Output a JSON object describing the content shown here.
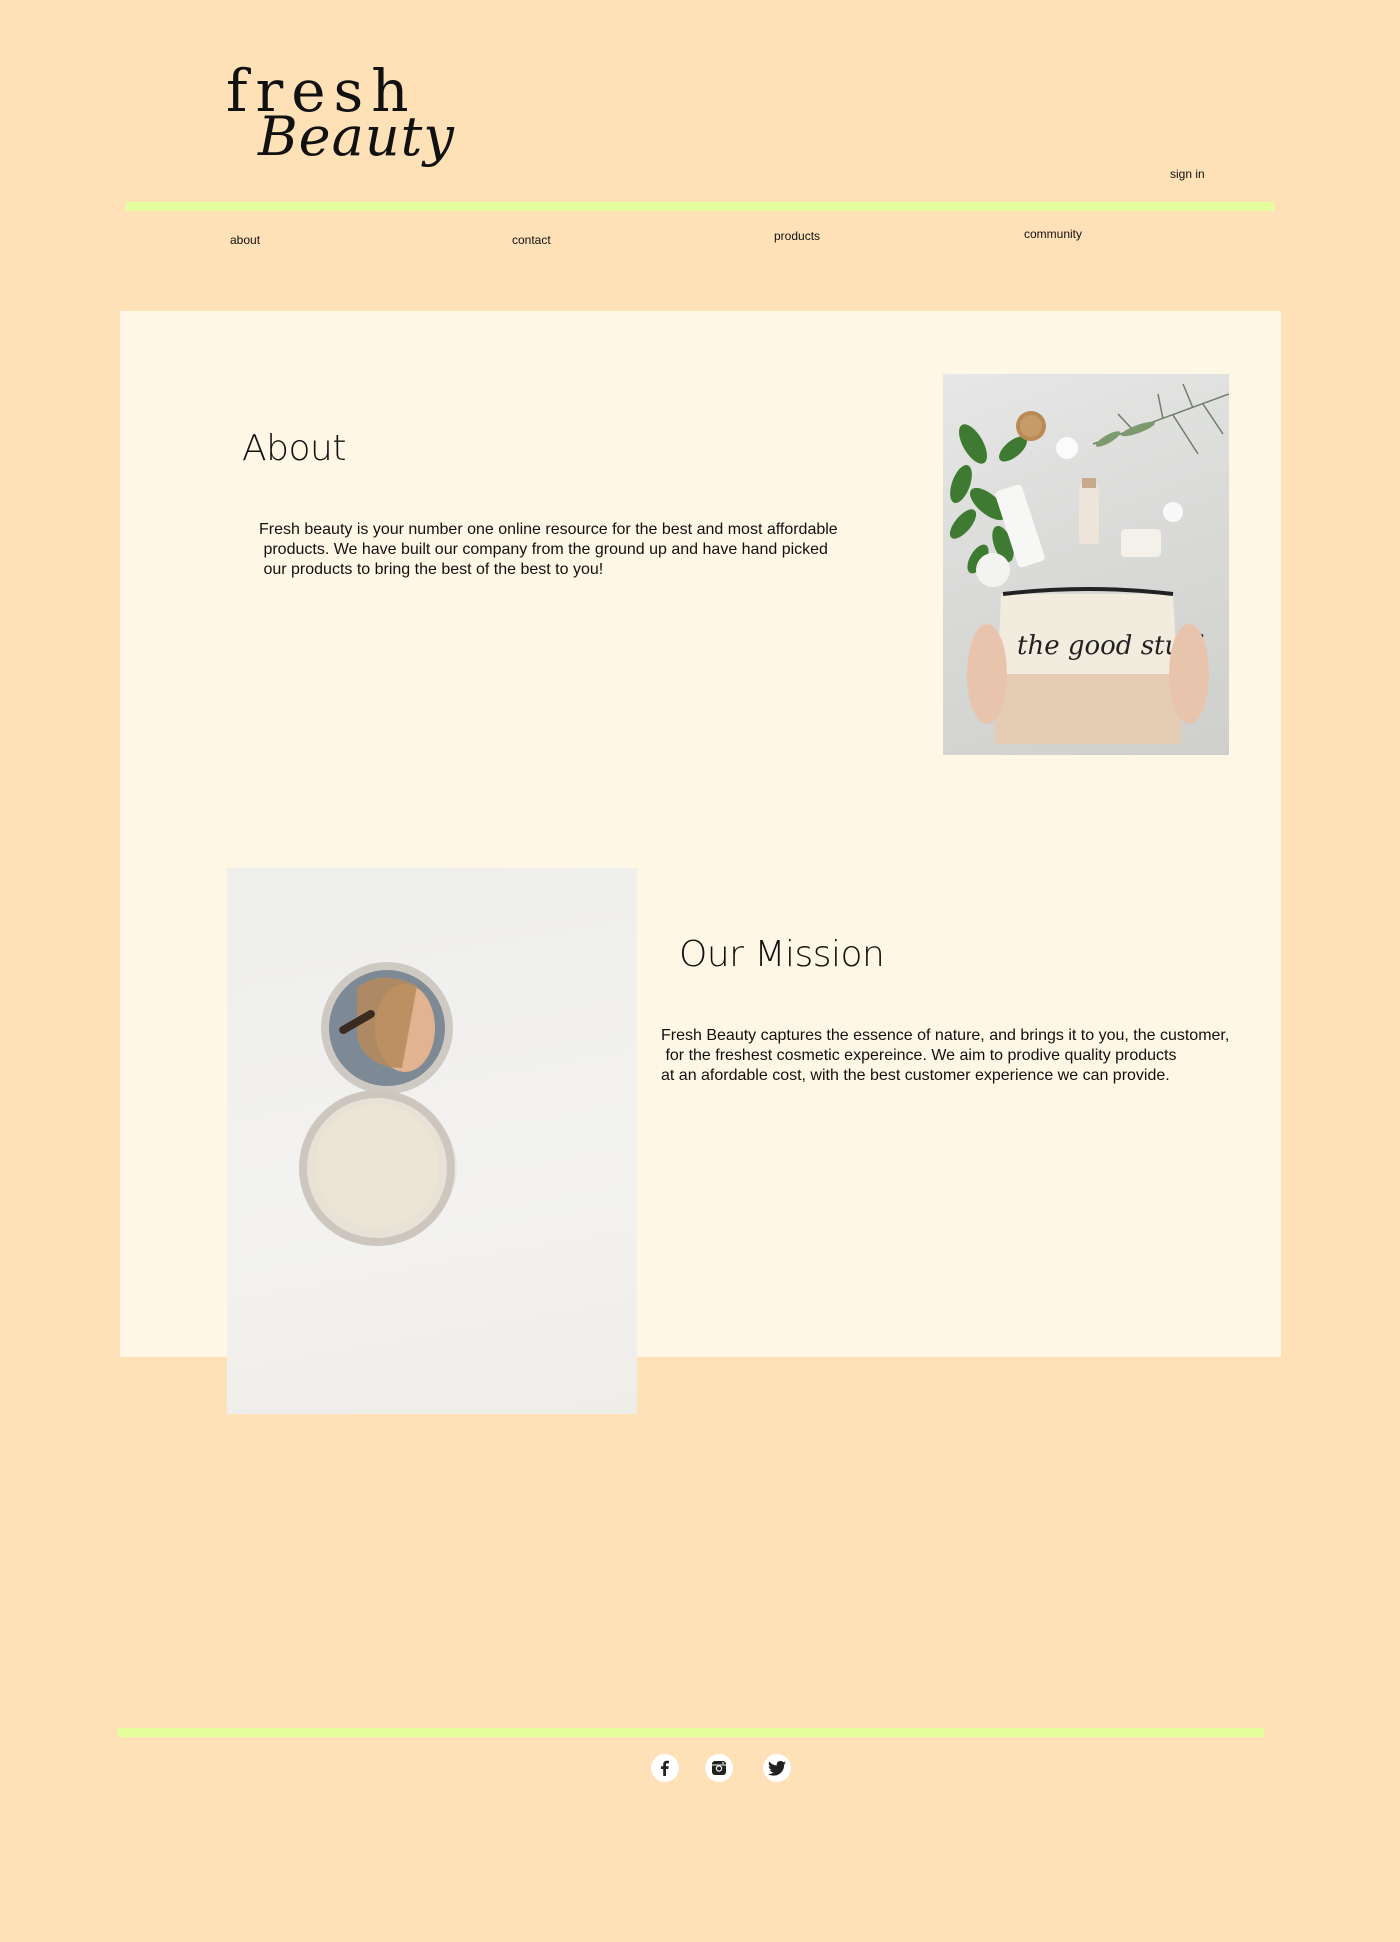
{
  "header": {
    "logo_line1": "fresh",
    "logo_line2": "Beauty",
    "sign_in": "sign in"
  },
  "nav": {
    "about": "about",
    "contact": "contact",
    "products": "products",
    "community": "community"
  },
  "about": {
    "title": "About",
    "text": "Fresh beauty is your number one online resource for the best and most affordable\n products. We have built our company from the ground up and have hand picked\n our products to bring the best of the best to you!",
    "photo_caption": "the good stuff"
  },
  "mission": {
    "title": "Our Mission",
    "text": "Fresh Beauty captures the essence of nature, and brings it to you, the customer,\n for the freshest cosmetic expereince. We aim to prodive quality products\nat an afordable cost, with the best customer experience we can provide."
  },
  "footer": {
    "social_icons": [
      "facebook-icon",
      "instagram-icon",
      "twitter-icon"
    ]
  },
  "colors": {
    "background": "#ffe1b8",
    "panel": "#fff7e5",
    "accent_line": "#e5ff9c"
  }
}
